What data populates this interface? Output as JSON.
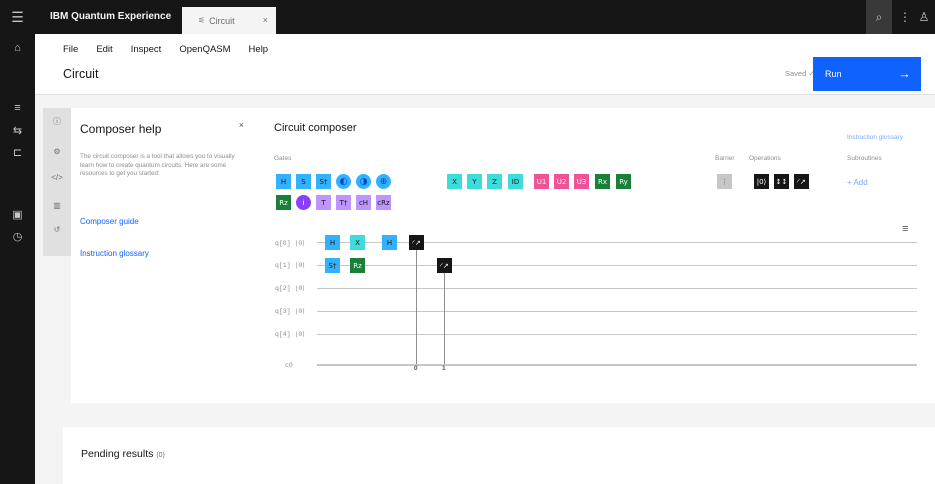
{
  "app": {
    "brand": "IBM Quantum Experience",
    "hamburger_icon": "menu-icon"
  },
  "tab": {
    "label": "Circuit",
    "close": "×"
  },
  "menu": [
    "File",
    "Edit",
    "Inspect",
    "OpenQASM",
    "Help"
  ],
  "page": {
    "title": "Circuit",
    "saved": "Saved",
    "run_label": "Run",
    "run_arrow": "→"
  },
  "help": {
    "title": "Composer help",
    "close": "×",
    "text": "The circuit composer is a tool that allows you to visually learn how to create quantum circuits. Here are some resources to get you started:",
    "link_guide": "Composer guide",
    "link_glossary": "Instruction glossary"
  },
  "composer": {
    "title": "Circuit composer",
    "glossary_link": "Instruction glossary",
    "labels": {
      "gates": "Gates",
      "barrier": "Barrier",
      "operations": "Operations",
      "subroutines": "Subroutines"
    },
    "add": "+ Add",
    "gates_row1": [
      "H",
      "S",
      "S†",
      "",
      "",
      "",
      "X",
      "Y",
      "Z",
      "ID",
      "U1",
      "U2",
      "U3",
      "Rx",
      "Ry"
    ],
    "gates_row2": [
      "Rz",
      "",
      "T",
      "T†",
      "cH",
      "cRz"
    ],
    "operations": [
      "|0⟩",
      "↕↕"
    ],
    "qubits": [
      "q[0]  |0⟩",
      "q[1]  |0⟩",
      "q[2]  |0⟩",
      "q[3]  |0⟩",
      "q[4]  |0⟩"
    ],
    "classical": "c0",
    "circuit_gates": {
      "q0": [
        "H",
        "X",
        "H"
      ],
      "q1": [
        "S†",
        "Rz"
      ]
    },
    "classical_indices": [
      "0",
      "1"
    ]
  },
  "results": {
    "label": "Pending results",
    "count": "(0)"
  },
  "colors": {
    "blue": "#33b1ff",
    "teal": "#3ddbd9",
    "pink": "#ee5396",
    "green": "#198038",
    "black": "#161616",
    "accent": "#0f62fe"
  }
}
